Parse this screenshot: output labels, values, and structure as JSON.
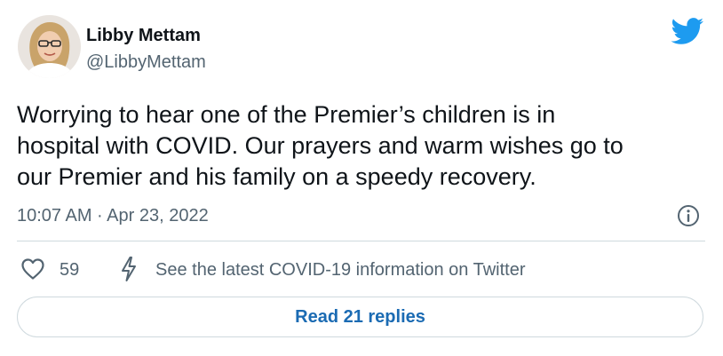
{
  "author": {
    "name": "Libby Mettam",
    "handle": "@LibbyMettam",
    "avatar_icon": "profile-photo"
  },
  "brand": {
    "icon": "twitter-bird-icon",
    "color": "#1d9bf0"
  },
  "tweet": {
    "lines": [
      "Worrying to hear one of the Premier’s children is in",
      "hospital with COVID. Our prayers and warm wishes go to",
      "our Premier and his family on a speedy recovery."
    ],
    "timestamp": "10:07 AM · Apr 23, 2022"
  },
  "actions": {
    "like_icon": "heart-icon",
    "like_count": "59",
    "covid_icon": "lightning-bolt-icon",
    "covid_info": "See the latest COVID-19 information on Twitter",
    "info_icon": "info-icon"
  },
  "replies": {
    "label": "Read 21 replies",
    "color": "#1b6bb3"
  }
}
